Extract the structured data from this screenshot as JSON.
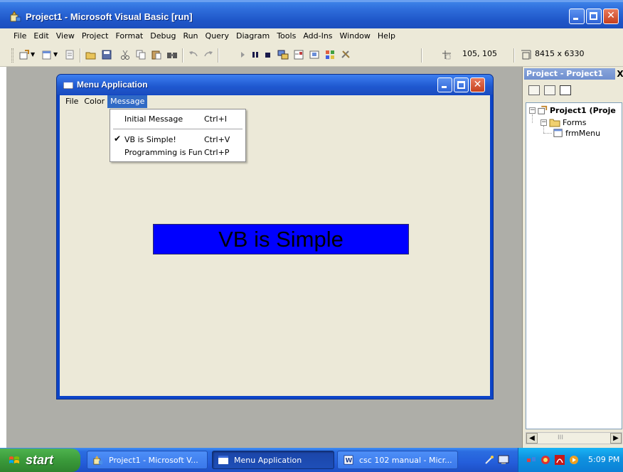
{
  "ide": {
    "title": "Project1 - Microsoft Visual Basic [run]",
    "menu": [
      "File",
      "Edit",
      "View",
      "Project",
      "Format",
      "Debug",
      "Run",
      "Query",
      "Diagram",
      "Tools",
      "Add-Ins",
      "Window",
      "Help"
    ],
    "toolbar": {
      "position_readout": "105, 105",
      "size_readout": "8415 x 6330",
      "icons": [
        "add-project-icon",
        "add-form-icon",
        "menu-editor-icon",
        "open-icon",
        "save-icon",
        "cut-icon",
        "copy-icon",
        "paste-icon",
        "find-icon",
        "undo-icon",
        "redo-icon",
        "start-icon",
        "break-icon",
        "end-icon",
        "project-explorer-icon",
        "properties-icon",
        "form-layout-icon",
        "object-browser-icon",
        "toolbox-icon"
      ]
    }
  },
  "project_explorer": {
    "header": "Project - Project1",
    "close": "X",
    "tree": {
      "root": "Project1 (Proje",
      "folder": "Forms",
      "item": "frmMenu"
    },
    "scroll_thumb": "III"
  },
  "form": {
    "title": "Menu Application",
    "menu": [
      "File",
      "Color",
      "Message"
    ],
    "open_menu": "Message",
    "dropdown": [
      {
        "label": "Initial Message",
        "shortcut": "Ctrl+I",
        "checked": false
      },
      {
        "label": "VB is Simple!",
        "shortcut": "Ctrl+V",
        "checked": true
      },
      {
        "label": "Programming is Fun",
        "shortcut": "Ctrl+P",
        "checked": false
      }
    ],
    "label_text": "VB is Simple",
    "label_back_color": "#0000ff"
  },
  "taskbar": {
    "start": "start",
    "buttons": [
      {
        "label": "Project1 - Microsoft V...",
        "active": false
      },
      {
        "label": "Menu Application",
        "active": true
      },
      {
        "label": "csc 102 manual - Micr...",
        "active": false
      }
    ],
    "clock": "5:09 PM"
  },
  "colors": {
    "xp_blue": "#245edb",
    "start_green": "#3a9a3a",
    "workspace_gray": "#aeaea8",
    "menu_highlight": "#316ac5"
  }
}
